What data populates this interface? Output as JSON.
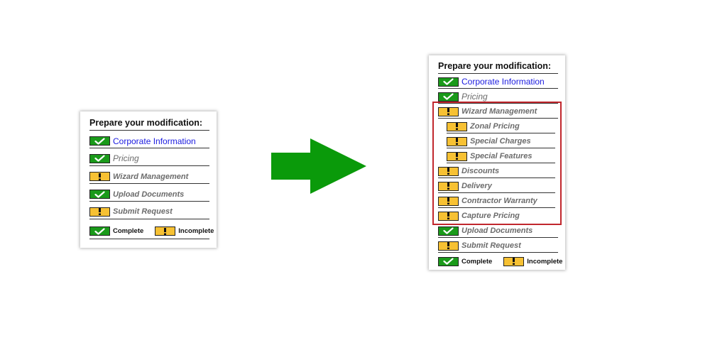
{
  "colors": {
    "complete": "#1a9a1a",
    "incomplete": "#f7c133",
    "link": "#1a1adf",
    "highlight": "#c1272d",
    "arrow": "#0a9a0a"
  },
  "before_panel": {
    "title": "Prepare your modification:",
    "items": [
      {
        "label": "Corporate Information",
        "status": "complete"
      },
      {
        "label": "Pricing",
        "status": "complete"
      },
      {
        "label": "Wizard Management",
        "status": "incomplete"
      },
      {
        "label": "Upload Documents",
        "status": "complete"
      },
      {
        "label": "Submit Request",
        "status": "incomplete"
      }
    ],
    "legend": {
      "complete": "Complete",
      "incomplete": "Incomplete"
    }
  },
  "after_panel": {
    "title": "Prepare your modification:",
    "items": [
      {
        "label": "Corporate Information",
        "status": "complete"
      },
      {
        "label": "Pricing",
        "status": "complete"
      },
      {
        "label": "Wizard Management",
        "status": "incomplete"
      },
      {
        "label": "Zonal Pricing",
        "status": "incomplete"
      },
      {
        "label": "Special Charges",
        "status": "incomplete"
      },
      {
        "label": "Special Features",
        "status": "incomplete"
      },
      {
        "label": "Discounts",
        "status": "incomplete"
      },
      {
        "label": "Delivery",
        "status": "incomplete"
      },
      {
        "label": "Contractor Warranty",
        "status": "incomplete"
      },
      {
        "label": "Capture Pricing",
        "status": "incomplete"
      },
      {
        "label": "Upload Documents",
        "status": "complete"
      },
      {
        "label": "Submit Request",
        "status": "incomplete"
      }
    ],
    "legend": {
      "complete": "Complete",
      "incomplete": "Incomplete"
    }
  }
}
